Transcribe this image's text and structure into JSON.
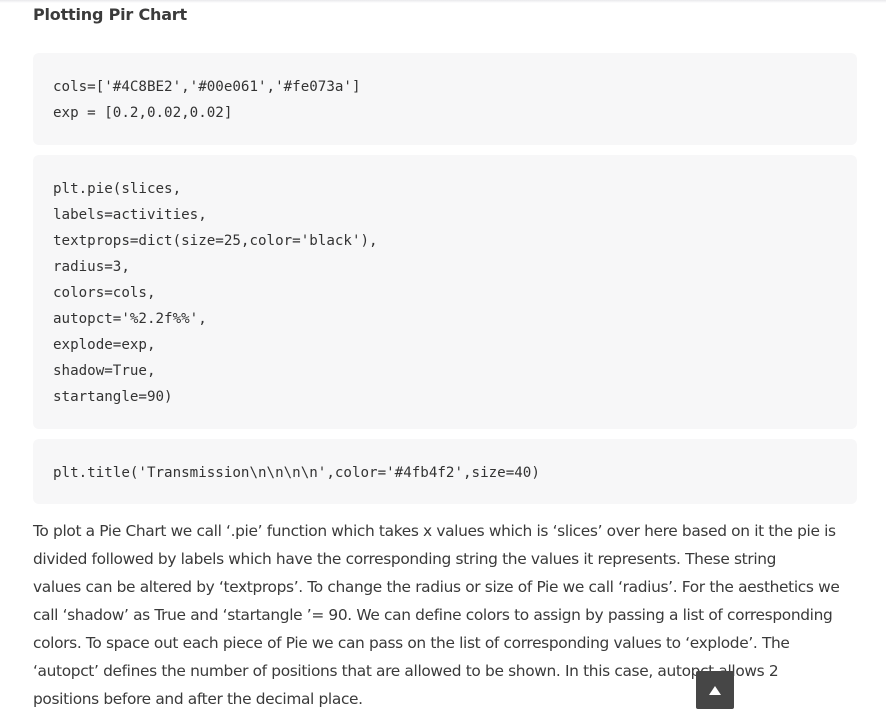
{
  "heading": "Plotting Pir Chart",
  "code_blocks": [
    [
      "cols=['#4C8BE2','#00e061','#fe073a']",
      "exp = [0.2,0.02,0.02]"
    ],
    [
      "plt.pie(slices,",
      "labels=activities,",
      "textprops=dict(size=25,color='black'),",
      "radius=3,",
      "colors=cols,",
      "autopct='%2.2f%%',",
      "explode=exp,",
      "shadow=True,",
      "startangle=90)"
    ],
    [
      "plt.title('Transmission\\n\\n\\n\\n',color='#4fb4f2',size=40)"
    ]
  ],
  "paragraph_lines": [
    "To plot a Pie Chart we call ‘.pie’ function which takes x values which is ‘slices’ over here based on it the pie is",
    "divided followed by labels which have the corresponding string the values it represents. These string",
    "values can be altered by ‘textprops’. To change the radius or size of Pie we call ‘radius’. For the aesthetics we",
    "call ‘shadow’ as True and ‘startangle ’= 90. We can define colors to assign by passing a list of corresponding",
    "colors. To space out each piece of Pie we can pass on the list of corresponding values to ‘explode’. The",
    "‘autopct’ defines the number of positions that are allowed to be shown. In this case, autopct allows 2",
    "positions before and after the decimal place."
  ],
  "scroll_top_icon": "arrow-up-icon"
}
